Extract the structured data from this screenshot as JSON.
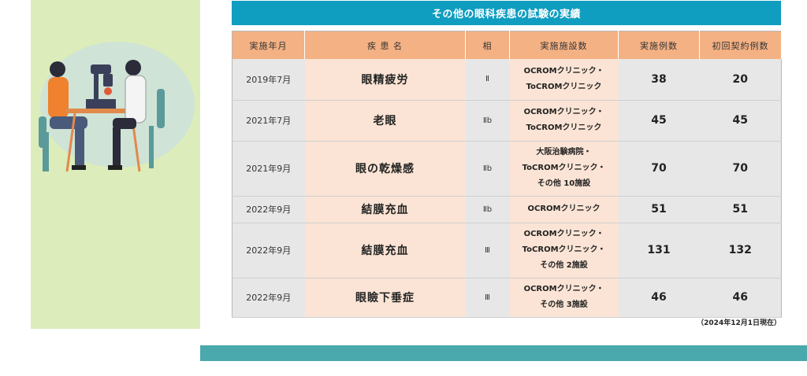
{
  "banner": {
    "title": "その他の眼科疾患の試験の実績"
  },
  "table": {
    "headers": [
      "実施年月",
      "疾 患 名",
      "相",
      "実施施設数",
      "実施例数",
      "初回契約例数"
    ],
    "rows": [
      {
        "date": "2019年7月",
        "disease": "眼精疲労",
        "phase": "Ⅱ",
        "sites": [
          "OCROMクリニック・",
          "ToCROMクリニック"
        ],
        "cases": "38",
        "initial": "20"
      },
      {
        "date": "2021年7月",
        "disease": "老眼",
        "phase": "Ⅱb",
        "sites": [
          "OCROMクリニック・",
          "ToCROMクリニック"
        ],
        "cases": "45",
        "initial": "45"
      },
      {
        "date": "2021年9月",
        "disease": "眼の乾燥感",
        "phase": "Ⅱb",
        "sites": [
          "大阪治験病院・",
          "ToCROMクリニック・",
          "その他 10施設"
        ],
        "cases": "70",
        "initial": "70"
      },
      {
        "date": "2022年9月",
        "disease": "結膜充血",
        "phase": "Ⅱb",
        "sites": [
          "OCROMクリニック"
        ],
        "cases": "51",
        "initial": "51"
      },
      {
        "date": "2022年9月",
        "disease": "結膜充血",
        "phase": "Ⅲ",
        "sites": [
          "OCROMクリニック・",
          "ToCROMクリニック・",
          "その他 2施設"
        ],
        "cases": "131",
        "initial": "132"
      },
      {
        "date": "2022年9月",
        "disease": "眼瞼下垂症",
        "phase": "Ⅲ",
        "sites": [
          "OCROMクリニック・",
          "その他 3施設"
        ],
        "cases": "46",
        "initial": "46"
      }
    ]
  },
  "note": "（2024年12月1日現在）",
  "colors": {
    "banner": "#0f9dc0",
    "header": "#f4b183",
    "accent_bar": "#4aa9ad",
    "side_panel": "#dcedbb"
  }
}
